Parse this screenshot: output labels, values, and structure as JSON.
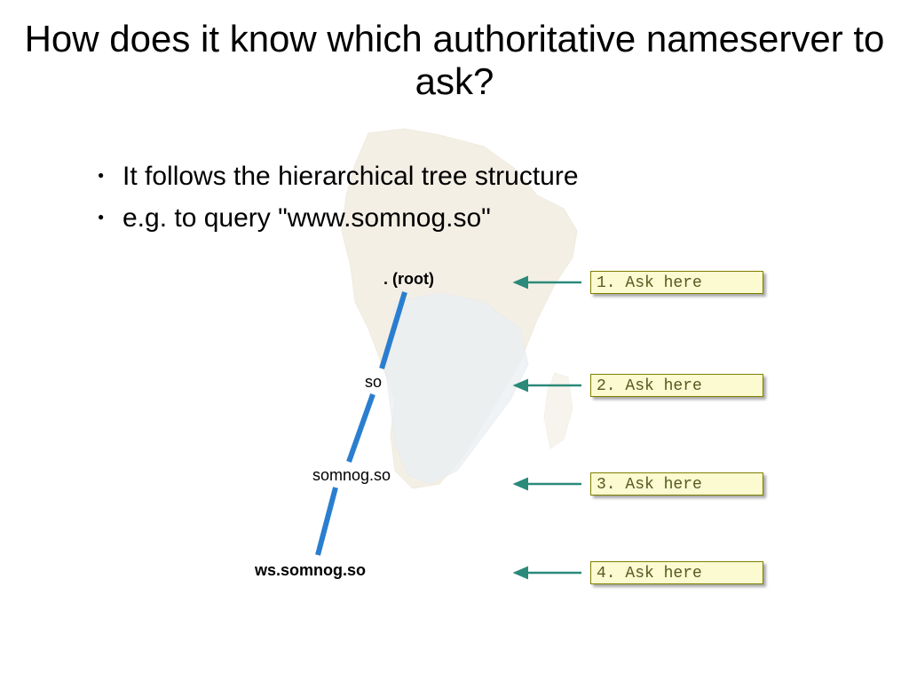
{
  "title": "How does it know which authoritative nameserver to ask?",
  "bullets": [
    "It follows the hierarchical tree structure",
    "e.g. to query \"www.somnog.so\""
  ],
  "tree": {
    "root": ".  (root)",
    "level1": "so",
    "level2": "somnog.so",
    "level3": "ws.somnog.so"
  },
  "ask": {
    "step1": "1. Ask here",
    "step2": "2. Ask here",
    "step3": "3. Ask here",
    "step4": "4. Ask here"
  }
}
